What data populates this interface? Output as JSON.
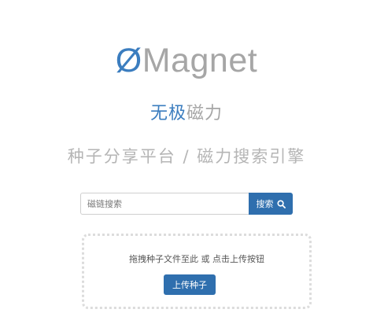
{
  "logo": {
    "mark": "Ø",
    "rest": "Magnet"
  },
  "subtitle": {
    "highlight": "无极",
    "rest": "磁力"
  },
  "tagline": "种子分享平台 / 磁力搜索引擎",
  "search": {
    "placeholder": "磁链搜索",
    "button_label": "搜索",
    "button_icon": "search-icon"
  },
  "dropzone": {
    "hint": "拖拽种子文件至此 或 点击上传按钮",
    "button_label": "上传种子"
  },
  "colors": {
    "brand_blue": "#3b7dbf",
    "button_blue": "#2f6fae",
    "muted_gray": "#a6a6a6"
  }
}
